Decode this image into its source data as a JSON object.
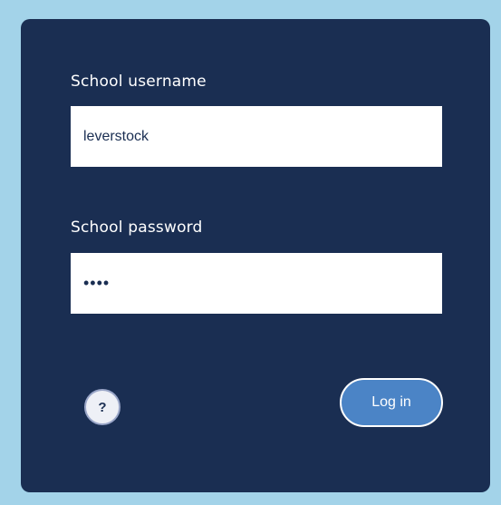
{
  "login_form": {
    "username_label": "School username",
    "username_value": "leverstock",
    "password_label": "School password",
    "password_value": "abcd",
    "help_label": "?",
    "login_label": "Log in"
  },
  "colors": {
    "background": "#a3d3e9",
    "panel": "#1a2e52",
    "login_button": "#4b84c6",
    "help_button": "#eef0f6"
  },
  "icons": {
    "help": "question-mark-icon"
  }
}
